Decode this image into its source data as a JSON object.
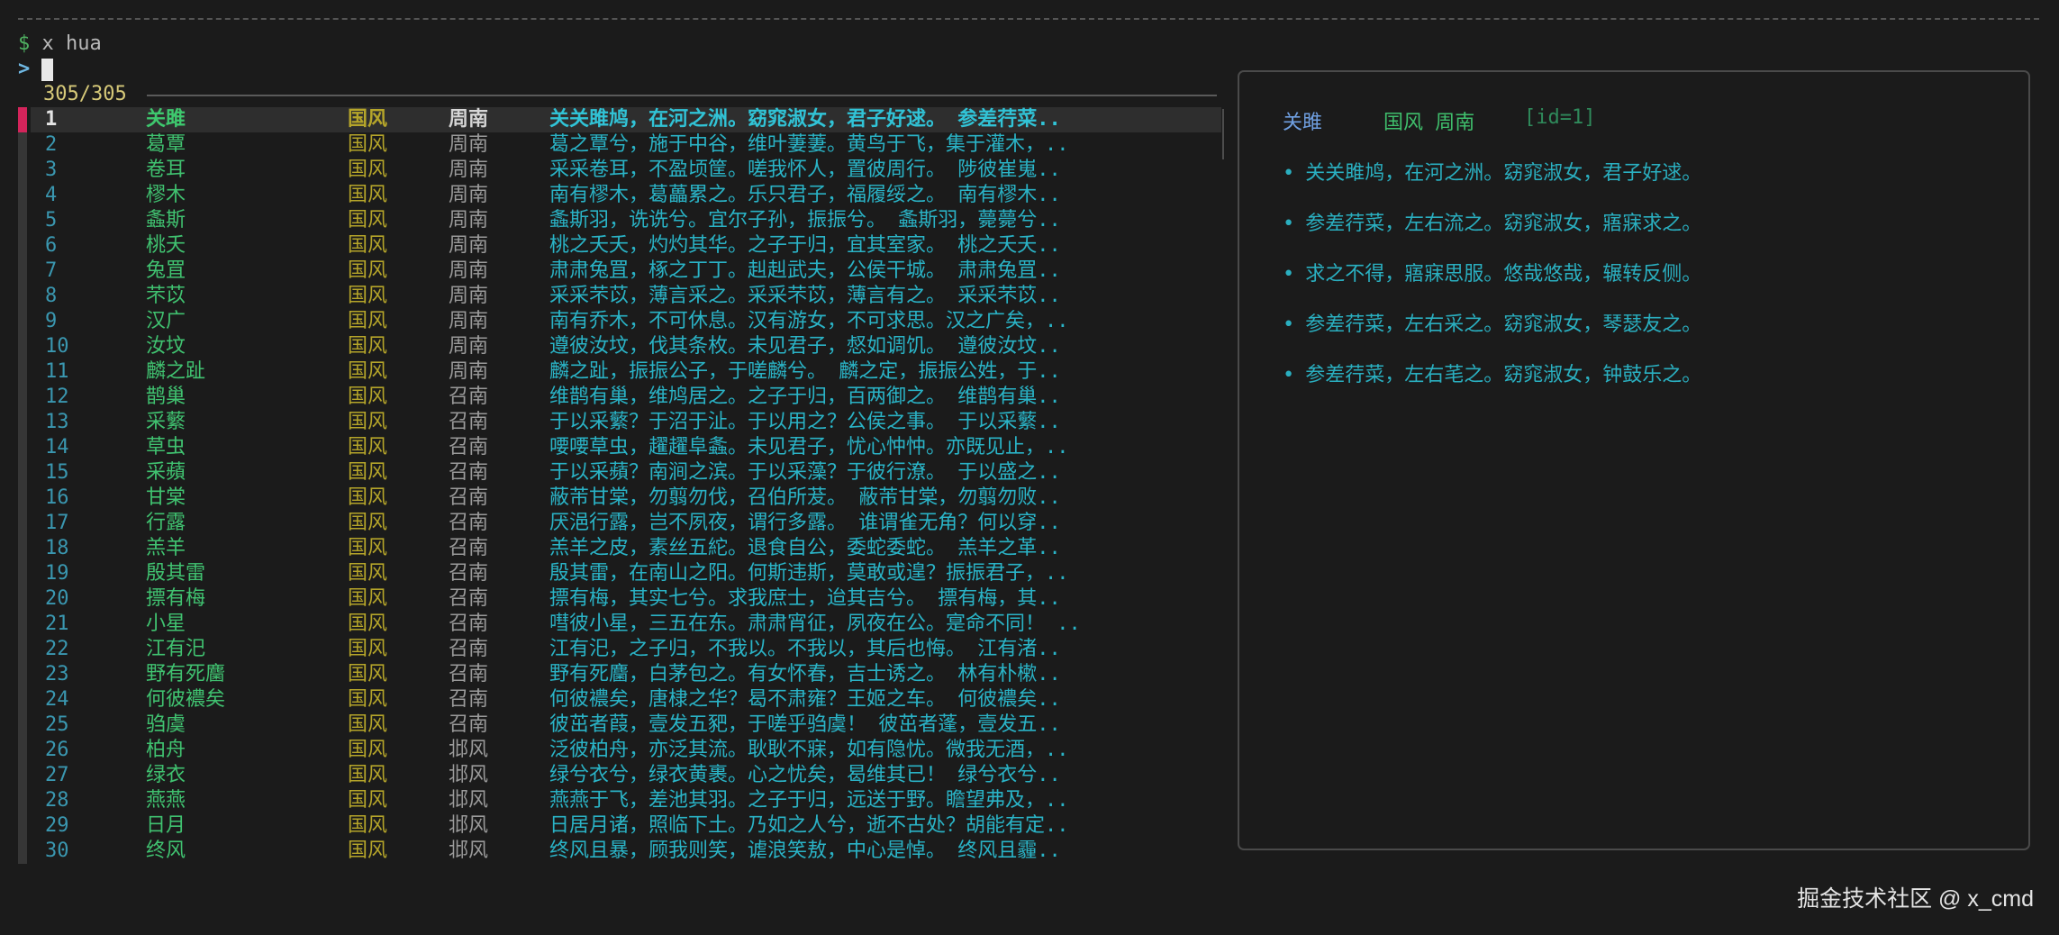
{
  "prompt": {
    "symbol": "$",
    "command": "x hua"
  },
  "input": {
    "symbol": ">",
    "value": ""
  },
  "status": {
    "count": "305/305"
  },
  "rows": [
    {
      "num": "1",
      "title": "关雎",
      "cat": "国风",
      "sec": "周南",
      "text": "关关雎鸠，在河之洲。窈窕淑女，君子好逑。  参差荇菜.."
    },
    {
      "num": "2",
      "title": "葛覃",
      "cat": "国风",
      "sec": "周南",
      "text": "葛之覃兮，施于中谷，维叶萋萋。黄鸟于飞，集于灌木，.."
    },
    {
      "num": "3",
      "title": "卷耳",
      "cat": "国风",
      "sec": "周南",
      "text": "采采卷耳，不盈顷筐。嗟我怀人，置彼周行。  陟彼崔嵬.."
    },
    {
      "num": "4",
      "title": "樛木",
      "cat": "国风",
      "sec": "周南",
      "text": "南有樛木，葛藟累之。乐只君子，福履绥之。  南有樛木.."
    },
    {
      "num": "5",
      "title": "螽斯",
      "cat": "国风",
      "sec": "周南",
      "text": "螽斯羽，诜诜兮。宜尔子孙，振振兮。  螽斯羽，薨薨兮.."
    },
    {
      "num": "6",
      "title": "桃夭",
      "cat": "国风",
      "sec": "周南",
      "text": "桃之夭夭，灼灼其华。之子于归，宜其室家。  桃之夭夭.."
    },
    {
      "num": "7",
      "title": "兔罝",
      "cat": "国风",
      "sec": "周南",
      "text": "肃肃兔罝，椓之丁丁。赳赳武夫，公侯干城。  肃肃兔罝.."
    },
    {
      "num": "8",
      "title": "芣苡",
      "cat": "国风",
      "sec": "周南",
      "text": "采采芣苡，薄言采之。采采芣苡，薄言有之。  采采芣苡.."
    },
    {
      "num": "9",
      "title": "汉广",
      "cat": "国风",
      "sec": "周南",
      "text": "南有乔木，不可休息。汉有游女，不可求思。汉之广矣，.."
    },
    {
      "num": "10",
      "title": "汝坟",
      "cat": "国风",
      "sec": "周南",
      "text": "遵彼汝坟，伐其条枚。未见君子，惄如调饥。  遵彼汝坟.."
    },
    {
      "num": "11",
      "title": "麟之趾",
      "cat": "国风",
      "sec": "周南",
      "text": "麟之趾，振振公子，于嗟麟兮。  麟之定，振振公姓，于.."
    },
    {
      "num": "12",
      "title": "鹊巢",
      "cat": "国风",
      "sec": "召南",
      "text": "维鹊有巢，维鸠居之。之子于归，百两御之。  维鹊有巢.."
    },
    {
      "num": "13",
      "title": "采蘩",
      "cat": "国风",
      "sec": "召南",
      "text": "于以采蘩？于沼于沚。于以用之？公侯之事。  于以采蘩.."
    },
    {
      "num": "14",
      "title": "草虫",
      "cat": "国风",
      "sec": "召南",
      "text": "喓喓草虫，趯趯阜螽。未见君子，忧心忡忡。亦既见止，.."
    },
    {
      "num": "15",
      "title": "采蘋",
      "cat": "国风",
      "sec": "召南",
      "text": "于以采蘋？南涧之滨。于以采藻？于彼行潦。  于以盛之.."
    },
    {
      "num": "16",
      "title": "甘棠",
      "cat": "国风",
      "sec": "召南",
      "text": "蔽芾甘棠，勿翦勿伐，召伯所茇。  蔽芾甘棠，勿翦勿败.."
    },
    {
      "num": "17",
      "title": "行露",
      "cat": "国风",
      "sec": "召南",
      "text": "厌浥行露，岂不夙夜，谓行多露。  谁谓雀无角？何以穿.."
    },
    {
      "num": "18",
      "title": "羔羊",
      "cat": "国风",
      "sec": "召南",
      "text": "羔羊之皮，素丝五紽。退食自公，委蛇委蛇。  羔羊之革.."
    },
    {
      "num": "19",
      "title": "殷其雷",
      "cat": "国风",
      "sec": "召南",
      "text": "殷其雷，在南山之阳。何斯违斯，莫敢或遑？振振君子，.."
    },
    {
      "num": "20",
      "title": "摽有梅",
      "cat": "国风",
      "sec": "召南",
      "text": "摽有梅，其实七兮。求我庶士，迨其吉兮。  摽有梅，其.."
    },
    {
      "num": "21",
      "title": "小星",
      "cat": "国风",
      "sec": "召南",
      "text": "嘒彼小星，三五在东。肃肃宵征，夙夜在公。寔命不同！ .."
    },
    {
      "num": "22",
      "title": "江有汜",
      "cat": "国风",
      "sec": "召南",
      "text": "江有汜，之子归，不我以。不我以，其后也悔。  江有渚.."
    },
    {
      "num": "23",
      "title": "野有死麕",
      "cat": "国风",
      "sec": "召南",
      "text": "野有死麕，白茅包之。有女怀春，吉士诱之。  林有朴樕.."
    },
    {
      "num": "24",
      "title": "何彼襛矣",
      "cat": "国风",
      "sec": "召南",
      "text": "何彼襛矣，唐棣之华？曷不肃雍？王姬之车。  何彼襛矣.."
    },
    {
      "num": "25",
      "title": "驺虞",
      "cat": "国风",
      "sec": "召南",
      "text": "彼茁者葭，壹发五豝，于嗟乎驺虞！  彼茁者蓬，壹发五.."
    },
    {
      "num": "26",
      "title": "柏舟",
      "cat": "国风",
      "sec": "邶风",
      "text": "泛彼柏舟，亦泛其流。耿耿不寐，如有隐忧。微我无酒，.."
    },
    {
      "num": "27",
      "title": "绿衣",
      "cat": "国风",
      "sec": "邶风",
      "text": "绿兮衣兮，绿衣黄裹。心之忧矣，曷维其已！  绿兮衣兮.."
    },
    {
      "num": "28",
      "title": "燕燕",
      "cat": "国风",
      "sec": "邶风",
      "text": "燕燕于飞，差池其羽。之子于归，远送于野。瞻望弗及，.."
    },
    {
      "num": "29",
      "title": "日月",
      "cat": "国风",
      "sec": "邶风",
      "text": "日居月诸，照临下土。乃如之人兮，逝不古处？胡能有定.."
    },
    {
      "num": "30",
      "title": "终风",
      "cat": "国风",
      "sec": "邶风",
      "text": "终风且暴，顾我则笑，谑浪笑敖，中心是悼。  终风且霾.."
    }
  ],
  "preview": {
    "title": "关雎",
    "meta": "国风 周南",
    "id": "[id=1]",
    "bullet": "•",
    "lines": [
      "关关雎鸠，在河之洲。窈窕淑女，君子好逑。",
      "参差荇菜，左右流之。窈窕淑女，寤寐求之。",
      "求之不得，寤寐思服。悠哉悠哉，辗转反侧。",
      "参差荇菜，左右采之。窈窕淑女，琴瑟友之。",
      "参差荇菜，左右芼之。窈窕淑女，钟鼓乐之。"
    ]
  },
  "watermark": "掘金技术社区 @ x_cmd"
}
